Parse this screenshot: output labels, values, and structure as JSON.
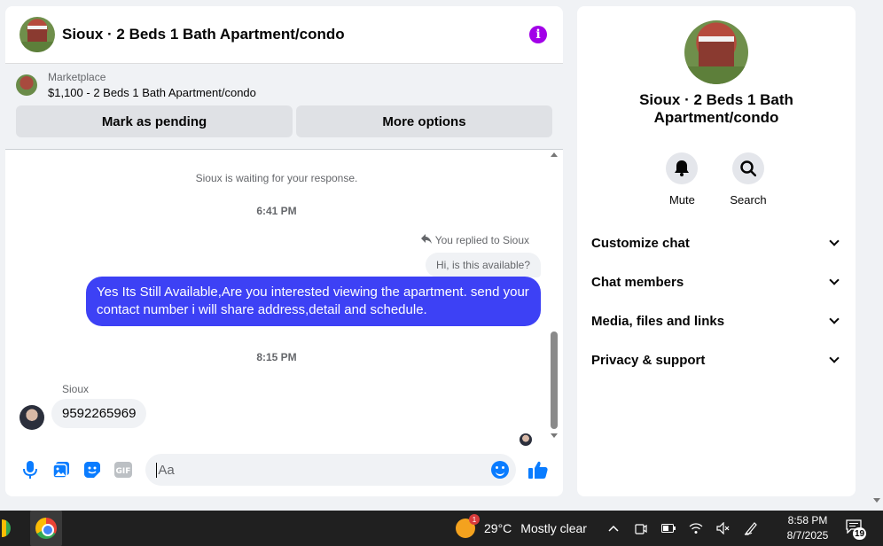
{
  "chat": {
    "title": "Sioux · 2 Beds 1 Bath Apartment/condo",
    "marketplace": {
      "label": "Marketplace",
      "listing": "$1,100 - 2 Beds 1 Bath Apartment/condo",
      "mark_pending_label": "Mark as pending",
      "more_options_label": "More options"
    },
    "messages": {
      "waiting_notice": "Sioux is waiting for your response.",
      "time_1": "6:41 PM",
      "replied_to": "You replied to Sioux",
      "quoted_message": "Hi, is this available?",
      "outgoing_message": "Yes Its Still Available,Are you interested viewing the apartment. send your contact number i will share address,detail and schedule.",
      "time_2": "8:15 PM",
      "sender_name": "Sioux",
      "incoming_message": "9592265969"
    },
    "composer": {
      "placeholder": "Aa",
      "icons": [
        "microphone-icon",
        "photo-icon",
        "sticker-icon",
        "gif-icon",
        "emoji-icon",
        "thumbs-up-icon"
      ]
    }
  },
  "side_panel": {
    "title": "Sioux · 2 Beds 1 Bath Apartment/condo",
    "actions": [
      {
        "label": "Mute",
        "icon": "bell-icon"
      },
      {
        "label": "Search",
        "icon": "search-icon"
      }
    ],
    "menu": [
      {
        "label": "Customize chat"
      },
      {
        "label": "Chat members"
      },
      {
        "label": "Media, files and links"
      },
      {
        "label": "Privacy & support"
      }
    ]
  },
  "taskbar": {
    "weather_badge": "1",
    "temperature": "29°C",
    "weather_text": "Mostly clear",
    "time": "8:58 PM",
    "date": "8/7/2025",
    "notification_count": "19"
  },
  "colors": {
    "accent_blue": "#0a7cff",
    "outgoing_bubble": "#3d41f5",
    "info_purple": "#a200e8",
    "taskbar_bg": "#202020"
  }
}
